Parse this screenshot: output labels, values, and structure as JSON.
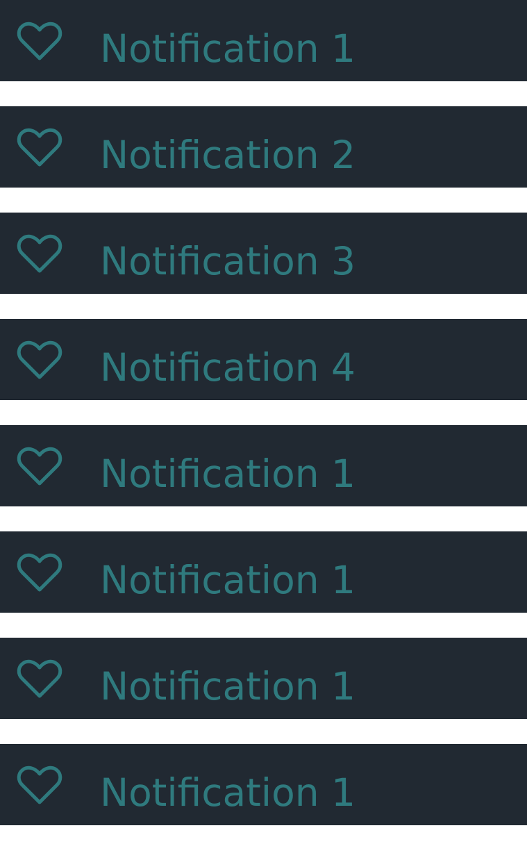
{
  "theme": {
    "item_background": "#212932",
    "accent": "#2f7a7e",
    "page_background": "#ffffff"
  },
  "notifications": [
    {
      "label": "Notification 1",
      "icon": "heart-outline-icon"
    },
    {
      "label": "Notification 2",
      "icon": "heart-outline-icon"
    },
    {
      "label": "Notification 3",
      "icon": "heart-outline-icon"
    },
    {
      "label": "Notification 4",
      "icon": "heart-outline-icon"
    },
    {
      "label": "Notification 1",
      "icon": "heart-outline-icon"
    },
    {
      "label": "Notification 1",
      "icon": "heart-outline-icon"
    },
    {
      "label": "Notification 1",
      "icon": "heart-outline-icon"
    },
    {
      "label": "Notification 1",
      "icon": "heart-outline-icon"
    }
  ]
}
